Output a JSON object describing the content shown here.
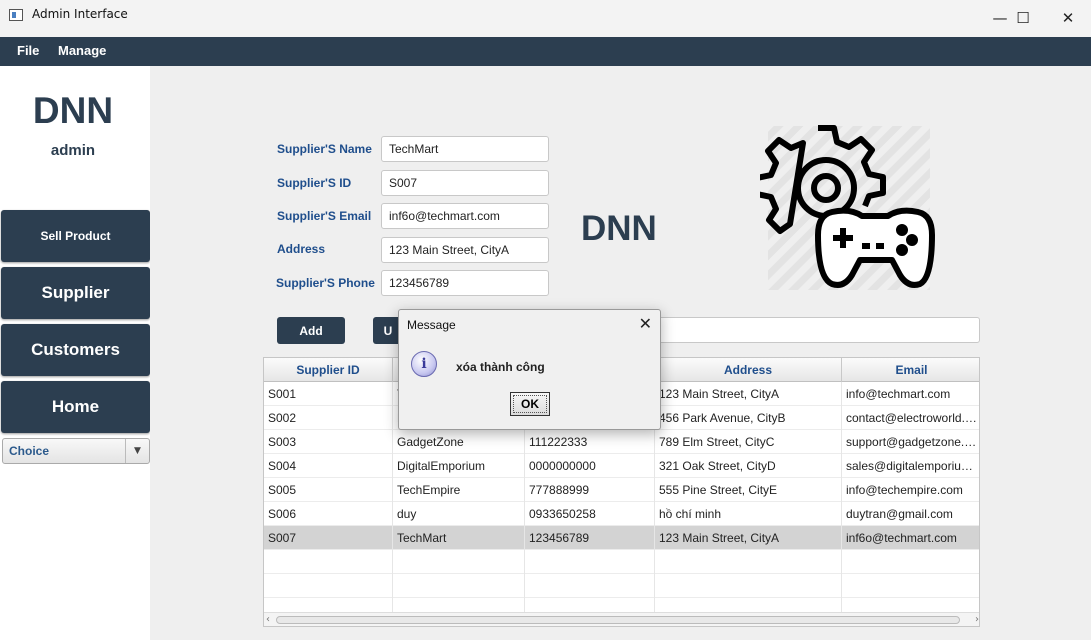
{
  "window": {
    "title": "Admin Interface",
    "minimize": "—",
    "maximize": "☐",
    "close": "✕"
  },
  "menu": {
    "file": "File",
    "manage": "Manage"
  },
  "sidebar": {
    "brand": "DNN",
    "role": "admin",
    "buttons": [
      "Sell Product",
      "Supplier",
      "Customers",
      "Home"
    ],
    "choice": "Choice"
  },
  "form": {
    "name_label": "Supplier'S Name",
    "name_value": "TechMart",
    "id_label": "Supplier'S ID",
    "id_value": "S007",
    "email_label": "Supplier'S Email",
    "email_value": "inf6o@techmart.com",
    "address_label": "Address",
    "address_value": "123 Main Street, CityA",
    "phone_label": "Supplier'S Phone",
    "phone_value": "123456789"
  },
  "center_logo": "DNN",
  "actions": {
    "add": "Add",
    "update": "U"
  },
  "table": {
    "headers": [
      "Supplier ID",
      "",
      "",
      "Address",
      "Email"
    ],
    "rows": [
      [
        "S001",
        "T",
        "",
        "123 Main Street, CityA",
        "info@techmart.com"
      ],
      [
        "S002",
        "E",
        "",
        "456 Park Avenue, CityB",
        "contact@electroworld.c..."
      ],
      [
        "S003",
        "GadgetZone",
        "111222333",
        "789 Elm Street, CityC",
        "support@gadgetzone.c..."
      ],
      [
        "S004",
        "DigitalEmporium",
        "0000000000",
        "321 Oak Street, CityD",
        "sales@digitalemporium..."
      ],
      [
        "S005",
        "TechEmpire",
        "777888999",
        "555 Pine Street, CityE",
        "info@techempire.com"
      ],
      [
        "S006",
        "duy",
        "0933650258",
        "hồ chí minh",
        "duytran@gmail.com"
      ],
      [
        "S007",
        "TechMart",
        "123456789",
        "123 Main Street, CityA",
        "inf6o@techmart.com"
      ]
    ]
  },
  "dialog": {
    "title": "Message",
    "message": "xóa thành công",
    "ok": "OK",
    "icon": "i"
  },
  "colors": {
    "primary": "#2c3e50",
    "label": "#1f4e8c"
  }
}
